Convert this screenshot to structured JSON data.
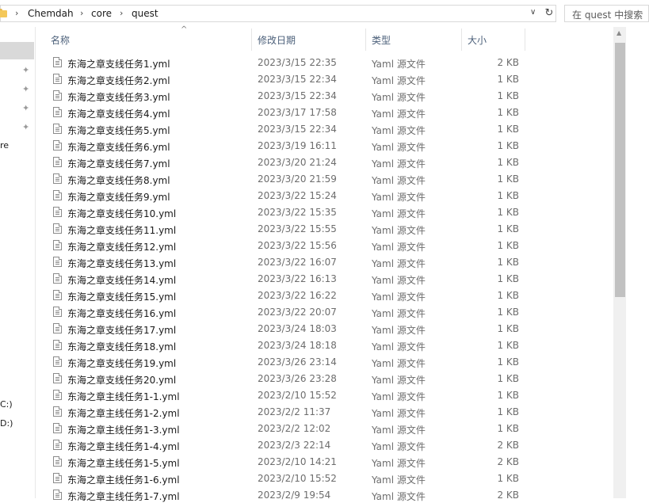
{
  "address": {
    "crumbs": [
      "Chemdah",
      "core",
      "quest"
    ],
    "separator": "›",
    "dropdown_glyph": "∨",
    "refresh_glyph": "↻"
  },
  "search": {
    "placeholder": "在 quest 中搜索"
  },
  "nav": {
    "partial_labels": [
      "re",
      "C:)",
      "D:)"
    ],
    "pin_icon": "pin-icon"
  },
  "columns": {
    "name": "名称",
    "date": "修改日期",
    "type": "类型",
    "size": "大小"
  },
  "sort_indicator": "^",
  "files": [
    {
      "name": "东海之章支线任务1.yml",
      "date": "2023/3/15 22:35",
      "type": "Yaml 源文件",
      "size": "2 KB"
    },
    {
      "name": "东海之章支线任务2.yml",
      "date": "2023/3/15 22:34",
      "type": "Yaml 源文件",
      "size": "1 KB"
    },
    {
      "name": "东海之章支线任务3.yml",
      "date": "2023/3/15 22:34",
      "type": "Yaml 源文件",
      "size": "1 KB"
    },
    {
      "name": "东海之章支线任务4.yml",
      "date": "2023/3/17 17:58",
      "type": "Yaml 源文件",
      "size": "1 KB"
    },
    {
      "name": "东海之章支线任务5.yml",
      "date": "2023/3/15 22:34",
      "type": "Yaml 源文件",
      "size": "1 KB"
    },
    {
      "name": "东海之章支线任务6.yml",
      "date": "2023/3/19 16:11",
      "type": "Yaml 源文件",
      "size": "1 KB"
    },
    {
      "name": "东海之章支线任务7.yml",
      "date": "2023/3/20 21:24",
      "type": "Yaml 源文件",
      "size": "1 KB"
    },
    {
      "name": "东海之章支线任务8.yml",
      "date": "2023/3/20 21:59",
      "type": "Yaml 源文件",
      "size": "1 KB"
    },
    {
      "name": "东海之章支线任务9.yml",
      "date": "2023/3/22 15:24",
      "type": "Yaml 源文件",
      "size": "1 KB"
    },
    {
      "name": "东海之章支线任务10.yml",
      "date": "2023/3/22 15:35",
      "type": "Yaml 源文件",
      "size": "1 KB"
    },
    {
      "name": "东海之章支线任务11.yml",
      "date": "2023/3/22 15:55",
      "type": "Yaml 源文件",
      "size": "1 KB"
    },
    {
      "name": "东海之章支线任务12.yml",
      "date": "2023/3/22 15:56",
      "type": "Yaml 源文件",
      "size": "1 KB"
    },
    {
      "name": "东海之章支线任务13.yml",
      "date": "2023/3/22 16:07",
      "type": "Yaml 源文件",
      "size": "1 KB"
    },
    {
      "name": "东海之章支线任务14.yml",
      "date": "2023/3/22 16:13",
      "type": "Yaml 源文件",
      "size": "1 KB"
    },
    {
      "name": "东海之章支线任务15.yml",
      "date": "2023/3/22 16:22",
      "type": "Yaml 源文件",
      "size": "1 KB"
    },
    {
      "name": "东海之章支线任务16.yml",
      "date": "2023/3/22 20:07",
      "type": "Yaml 源文件",
      "size": "1 KB"
    },
    {
      "name": "东海之章支线任务17.yml",
      "date": "2023/3/24 18:03",
      "type": "Yaml 源文件",
      "size": "1 KB"
    },
    {
      "name": "东海之章支线任务18.yml",
      "date": "2023/3/24 18:18",
      "type": "Yaml 源文件",
      "size": "1 KB"
    },
    {
      "name": "东海之章支线任务19.yml",
      "date": "2023/3/26 23:14",
      "type": "Yaml 源文件",
      "size": "1 KB"
    },
    {
      "name": "东海之章支线任务20.yml",
      "date": "2023/3/26 23:28",
      "type": "Yaml 源文件",
      "size": "1 KB"
    },
    {
      "name": "东海之章主线任务1-1.yml",
      "date": "2023/2/10 15:52",
      "type": "Yaml 源文件",
      "size": "1 KB"
    },
    {
      "name": "东海之章主线任务1-2.yml",
      "date": "2023/2/2 11:37",
      "type": "Yaml 源文件",
      "size": "1 KB"
    },
    {
      "name": "东海之章主线任务1-3.yml",
      "date": "2023/2/2 12:02",
      "type": "Yaml 源文件",
      "size": "1 KB"
    },
    {
      "name": "东海之章主线任务1-4.yml",
      "date": "2023/2/3 22:14",
      "type": "Yaml 源文件",
      "size": "2 KB"
    },
    {
      "name": "东海之章主线任务1-5.yml",
      "date": "2023/2/10 14:21",
      "type": "Yaml 源文件",
      "size": "2 KB"
    },
    {
      "name": "东海之章主线任务1-6.yml",
      "date": "2023/2/10 15:52",
      "type": "Yaml 源文件",
      "size": "1 KB"
    },
    {
      "name": "东海之章主线任务1-7.yml",
      "date": "2023/2/9 19:54",
      "type": "Yaml 源文件",
      "size": "2 KB"
    }
  ]
}
